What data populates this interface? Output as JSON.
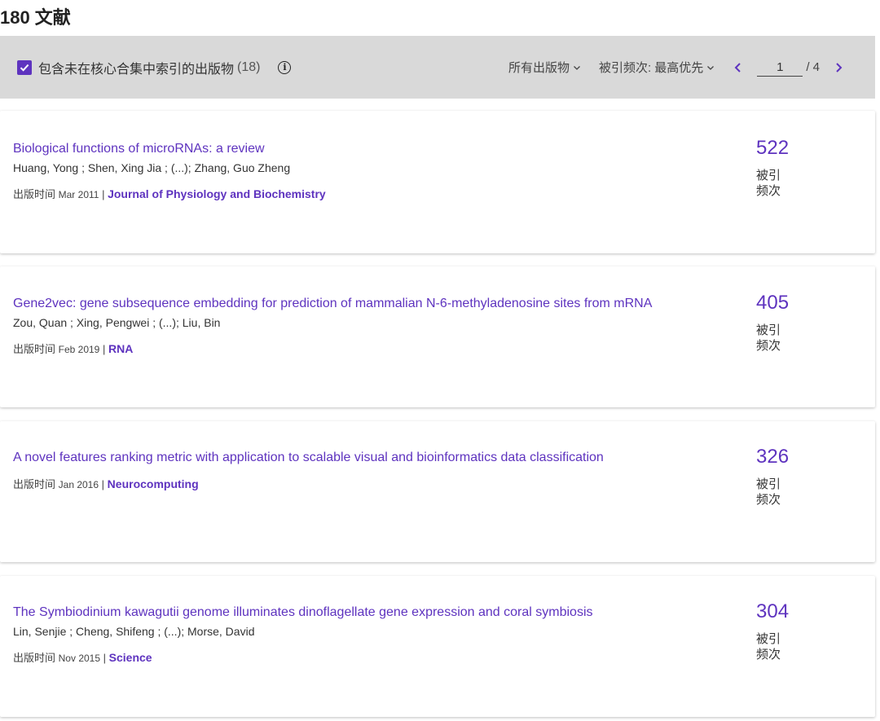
{
  "header": {
    "count": "180",
    "label": "文献"
  },
  "toolbar": {
    "include_label": "包含未在核心合集中索引的出版物",
    "include_count": "(18)",
    "filter_label": "所有出版物",
    "sort_label": "被引频次: 最高优先",
    "page_current": "1",
    "page_total": "/ 4"
  },
  "colors": {
    "accent": "#5e33bf",
    "toolbar_bg": "#d9d9d9"
  },
  "records": [
    {
      "title": "Biological functions of microRNAs: a review",
      "authors": "Huang, Yong ; Shen, Xing Jia ; (...); Zhang, Guo Zheng",
      "pub_prefix": "出版时间",
      "pub_date": "Mar 2011",
      "separator": "|",
      "journal": "Journal of Physiology and Biochemistry",
      "citations": "522",
      "citations_label": "被引频次"
    },
    {
      "title": "Gene2vec: gene subsequence embedding for prediction of mammalian N-6-methyladenosine sites from mRNA",
      "authors": "Zou, Quan ; Xing, Pengwei ; (...); Liu, Bin",
      "pub_prefix": "出版时间",
      "pub_date": "Feb 2019",
      "separator": "|",
      "journal": "RNA",
      "citations": "405",
      "citations_label": "被引频次"
    },
    {
      "title": "A novel features ranking metric with application to scalable visual and bioinformatics data classification",
      "authors": "",
      "pub_prefix": "出版时间",
      "pub_date": "Jan 2016",
      "separator": "|",
      "journal": "Neurocomputing",
      "citations": "326",
      "citations_label": "被引频次"
    },
    {
      "title": "The Symbiodinium kawagutii genome illuminates dinoflagellate gene expression and coral symbiosis",
      "authors": "Lin, Senjie ; Cheng, Shifeng ; (...); Morse, David",
      "pub_prefix": "出版时间",
      "pub_date": "Nov 2015",
      "separator": "|",
      "journal": "Science",
      "citations": "304",
      "citations_label": "被引频次"
    }
  ]
}
